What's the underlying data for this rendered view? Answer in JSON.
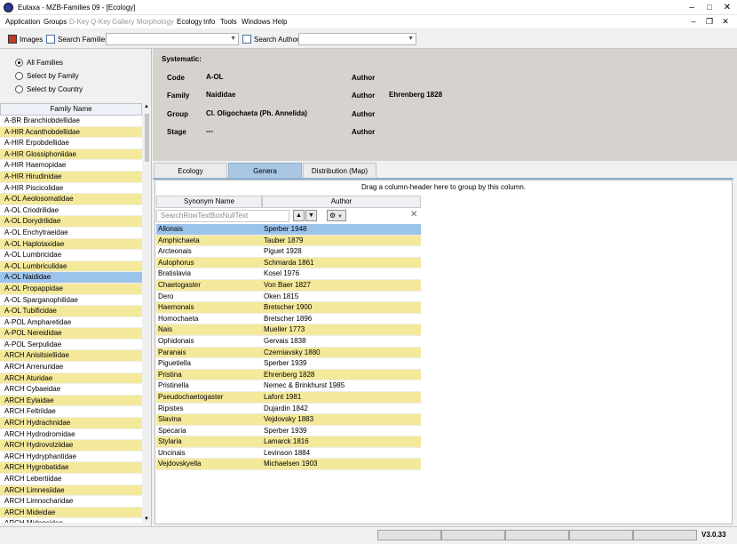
{
  "window": {
    "title": "Eutaxa - MZB-Families 09 - [Ecology]"
  },
  "menu": [
    {
      "label": "Application",
      "enabled": true
    },
    {
      "label": "Groups",
      "enabled": true
    },
    {
      "label": "D-Key",
      "enabled": false
    },
    {
      "label": "Q-Key",
      "enabled": false
    },
    {
      "label": "Gallery",
      "enabled": false
    },
    {
      "label": "Morphology",
      "enabled": false
    },
    {
      "label": "Ecology",
      "enabled": true
    },
    {
      "label": "Info",
      "enabled": true
    },
    {
      "label": "Tools",
      "enabled": true
    },
    {
      "label": "Windows",
      "enabled": true
    },
    {
      "label": "Help",
      "enabled": true
    }
  ],
  "toolbar": {
    "images_label": "Images",
    "search_families_label": "Search Families",
    "search_author_label": "Search Author",
    "families_combo_value": "",
    "author_combo_value": ""
  },
  "filter": {
    "options": [
      "All Families",
      "Select by Family",
      "Select by Country"
    ],
    "selected": "All Families"
  },
  "families": {
    "header": "Family Name",
    "rows": [
      "A-BR Branchiobdellidae",
      "A-HIR Acanthobdellidae",
      "A-HIR Erpobdellidae",
      "A-HIR Glossiphoniidae",
      "A-HIR Haemopidae",
      "A-HIR Hirudinidae",
      "A-HIR Piscicolidae",
      "A-OL Aeolosomatidae",
      "A-OL Criodrilidae",
      "A-OL Dorydrilidae",
      "A-OL Enchytraeidae",
      "A-OL Haplotaxidae",
      "A-OL Lumbricidae",
      "A-OL Lumbriculidae",
      "A-OL Naididae",
      "A-OL Propappidae",
      "A-OL Sparganophilidae",
      "A-OL Tubificidae",
      "A-POL Ampharetidae",
      "A-POL Nereididae",
      "A-POL Serpulidae",
      "ARCH Anisitsiellidae",
      "ARCH Arrenuridae",
      "ARCH Aturidae",
      "ARCH Cybaeidae",
      "ARCH Eylaidae",
      "ARCH Feltriidae",
      "ARCH Hydrachnidae",
      "ARCH Hydrodromidae",
      "ARCH Hydrovolziidae",
      "ARCH Hydryphantidae",
      "ARCH Hygrobatidae",
      "ARCH Lebertiidae",
      "ARCH Limnesiidae",
      "ARCH Limnocharidae",
      "ARCH Mideidae",
      "ARCH Midopsidae"
    ],
    "selected_index": 14
  },
  "systematic": {
    "title": "Systematic:",
    "fields": [
      {
        "label": "Code",
        "value": "A-OL",
        "author_label": "Author",
        "author_value": ""
      },
      {
        "label": "Family",
        "value": "Naididae",
        "author_label": "Author",
        "author_value": "Ehrenberg 1828"
      },
      {
        "label": "Group",
        "value": "Cl. Oligochaeta (Ph. Annelida)",
        "author_label": "Author",
        "author_value": ""
      },
      {
        "label": "Stage",
        "value": "---",
        "author_label": "Author",
        "author_value": ""
      }
    ]
  },
  "tabs": [
    {
      "label": "Ecology",
      "active": false
    },
    {
      "label": "Genera",
      "active": true
    },
    {
      "label": "Distribution (Map)",
      "active": false
    }
  ],
  "genera": {
    "group_hint": "Drag a column-header here to group by this column.",
    "col_synonym": "Synonym Name",
    "col_author": "Author",
    "search_placeholder": "SearchRowTextBoxNullText",
    "rows": [
      [
        "Allonais",
        "Sperber 1948"
      ],
      [
        "Amphichaeta",
        "Tauber 1879"
      ],
      [
        "Arcteonais",
        "Piguet 1928"
      ],
      [
        "Aulophorus",
        "Schmarda 1861"
      ],
      [
        "Bratislavia",
        "Kosel 1976"
      ],
      [
        "Chaetogaster",
        "Von Baer 1827"
      ],
      [
        "Dero",
        "Oken 1815"
      ],
      [
        "Haemonais",
        "Bretscher 1900"
      ],
      [
        "Homochaeta",
        "Bretscher 1896"
      ],
      [
        "Nais",
        "Mueller 1773"
      ],
      [
        "Ophidonais",
        "Gervais 1838"
      ],
      [
        "Paranais",
        "Czerniavsky 1880"
      ],
      [
        "Piguetiella",
        "Sperber 1939"
      ],
      [
        "Pristina",
        "Ehrenberg 1828"
      ],
      [
        "Pristinella",
        "Nemec & Brinkhurst 1985"
      ],
      [
        "Pseudochaetogaster",
        "Lafont 1981"
      ],
      [
        "Ripistes",
        "Dujardin 1842"
      ],
      [
        "Slavina",
        "Vejdovsky 1883"
      ],
      [
        "Specaria",
        "Sperber 1939"
      ],
      [
        "Stylaria",
        "Lamarck 1816"
      ],
      [
        "Uncinais",
        "Levinson 1884"
      ],
      [
        "Vejdovskyella",
        "Michaelsen 1903"
      ]
    ],
    "selected_index": 0
  },
  "status": {
    "version": "V3.0.33"
  },
  "colors": {
    "alt_row": "#f4e99a",
    "selected_row": "#9cc3ea",
    "active_tab": "#a9c7e2"
  }
}
